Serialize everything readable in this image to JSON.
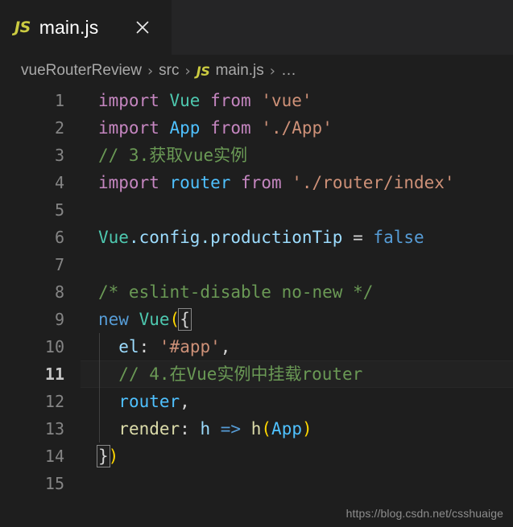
{
  "window": {
    "background_color": "#1e1e1e",
    "tabbar_color": "#252526"
  },
  "tab": {
    "file_icon_label": "JS",
    "file_icon_color": "#cbcb41",
    "title": "main.js",
    "close_icon": "close-icon"
  },
  "breadcrumb": {
    "separator": "›",
    "items": [
      {
        "label": "vueRouterReview",
        "type": "folder"
      },
      {
        "label": "src",
        "type": "folder"
      },
      {
        "label": "main.js",
        "type": "file",
        "icon_label": "JS"
      },
      {
        "label": "…",
        "type": "symbol"
      }
    ]
  },
  "editor": {
    "language": "javascript",
    "active_line": 11,
    "total_lines": 15,
    "line_numbers": [
      "1",
      "2",
      "3",
      "4",
      "5",
      "6",
      "7",
      "8",
      "9",
      "10",
      "11",
      "12",
      "13",
      "14",
      "15"
    ],
    "lines": [
      {
        "n": "1",
        "text": "import Vue from 'vue'"
      },
      {
        "n": "2",
        "text": "import App from './App'"
      },
      {
        "n": "3",
        "text": "// 3.获取vue实例"
      },
      {
        "n": "4",
        "text": "import router from './router/index'"
      },
      {
        "n": "5",
        "text": ""
      },
      {
        "n": "6",
        "text": "Vue.config.productionTip = false"
      },
      {
        "n": "7",
        "text": ""
      },
      {
        "n": "8",
        "text": "/* eslint-disable no-new */"
      },
      {
        "n": "9",
        "text": "new Vue({"
      },
      {
        "n": "10",
        "text": "  el: '#app',"
      },
      {
        "n": "11",
        "text": "  // 4.在Vue实例中挂载router"
      },
      {
        "n": "12",
        "text": "  router,"
      },
      {
        "n": "13",
        "text": "  render: h => h(App)"
      },
      {
        "n": "14",
        "text": "})"
      },
      {
        "n": "15",
        "text": ""
      }
    ],
    "tokens": {
      "l1": {
        "kw1": "import",
        "sp1": " ",
        "cls": "Vue",
        "sp2": " ",
        "kw2": "from",
        "sp3": " ",
        "str": "'vue'"
      },
      "l2": {
        "kw1": "import",
        "sp1": " ",
        "cls": "App",
        "sp2": " ",
        "kw2": "from",
        "sp3": " ",
        "str": "'./App'"
      },
      "l3": {
        "comment": "// 3.获取vue实例"
      },
      "l4": {
        "kw1": "import",
        "sp1": " ",
        "id": "router",
        "sp2": " ",
        "kw2": "from",
        "sp3": " ",
        "str": "'./router/index'"
      },
      "l6": {
        "obj": "Vue",
        "prop": ".config.productionTip",
        "sp1": " ",
        "eq": "=",
        "sp2": " ",
        "val": "false"
      },
      "l8": {
        "comment": "/* eslint-disable no-new */"
      },
      "l9": {
        "kw": "new",
        "sp": " ",
        "cls": "Vue",
        "paren": "(",
        "brace": "{"
      },
      "l10": {
        "indent": "  ",
        "key": "el",
        "colon": ":",
        "sp": " ",
        "str": "'#app'",
        "comma": ","
      },
      "l11": {
        "indent": "  ",
        "comment": "// 4.在Vue实例中挂载router"
      },
      "l12": {
        "indent": "  ",
        "id": "router",
        "comma": ","
      },
      "l13": {
        "indent": "  ",
        "key": "render",
        "colon": ":",
        "sp1": " ",
        "param": "h",
        "sp2": " ",
        "arrow": "=>",
        "sp3": " ",
        "fn": "h",
        "lparen": "(",
        "arg": "App",
        "rparen": ")"
      },
      "l14": {
        "brace": "}",
        "paren": ")"
      }
    },
    "theme_colors": {
      "keyword": "#c586c0",
      "control": "#569cd6",
      "identifier": "#4fc1ff",
      "variable": "#9cdcfe",
      "string": "#ce9178",
      "comment": "#6a9955",
      "class": "#4ec9b0",
      "function": "#dcdcaa",
      "punctuation": "#d4d4d4",
      "line_number": "#858585",
      "active_line_number": "#c6c6c6"
    }
  },
  "watermark": {
    "text": "https://blog.csdn.net/csshuaige"
  }
}
